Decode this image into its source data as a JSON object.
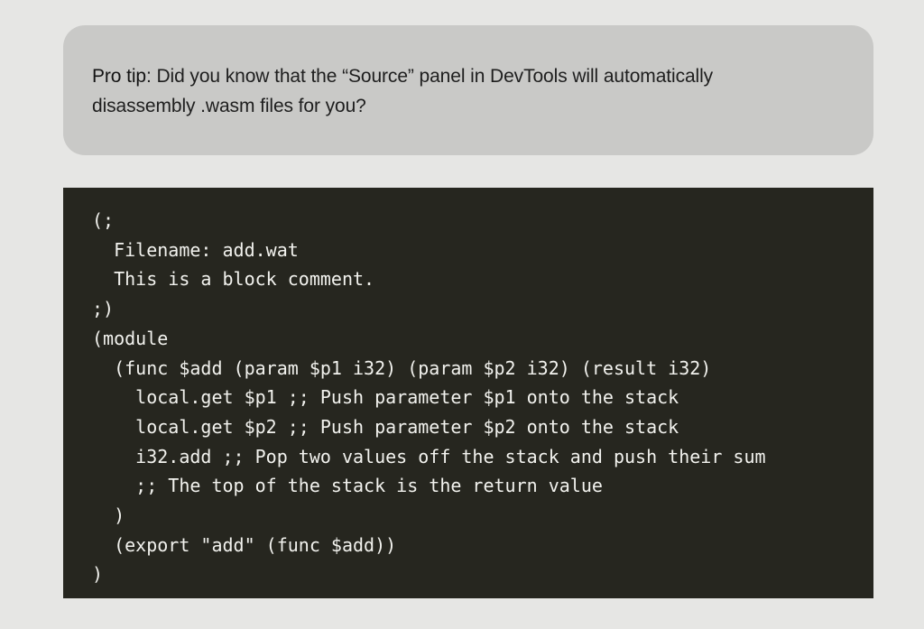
{
  "tip": {
    "label": "Pro tip",
    "separator": ":",
    "body": " Did you know that the “Source” panel in DevTools will automatically disassembly .wasm files for you?"
  },
  "code": {
    "lines": [
      "(;",
      "  Filename: add.wat",
      "  This is a block comment.",
      ";)",
      "(module",
      "  (func $add (param $p1 i32) (param $p2 i32) (result i32)",
      "    local.get $p1 ;; Push parameter $p1 onto the stack",
      "    local.get $p2 ;; Push parameter $p2 onto the stack",
      "    i32.add ;; Pop two values off the stack and push their sum",
      "    ;; The top of the stack is the return value",
      "  )",
      "  (export \"add\" (func $add))",
      ")"
    ]
  }
}
